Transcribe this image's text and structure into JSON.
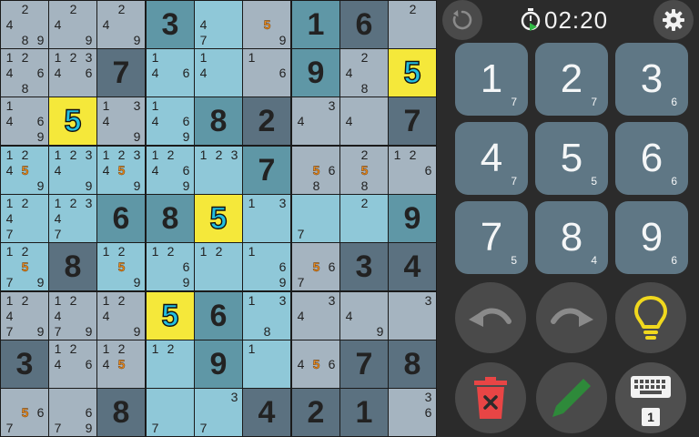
{
  "timer": {
    "value": "02:20"
  },
  "colors": {
    "cell_gray": "#a5b4c0",
    "cell_light": "#8fc8d8",
    "cell_dark": "#5b7180",
    "cell_teal": "#5f97a6",
    "cell_selected": "#f5e83a",
    "highlight_digit": "#22bfe0",
    "highlight_note": "#e88a1c",
    "numpad_button": "#5f7785",
    "panel_background": "#2b2b2b",
    "hint_icon": "#f0d81e",
    "erase_icon": "#e84545",
    "pencil_icon": "#2e8a3a"
  },
  "board": [
    [
      {
        "bg": "gray",
        "notes": [
          "2",
          "4",
          "8",
          "9"
        ]
      },
      {
        "bg": "gray",
        "notes": [
          "2",
          "4",
          "9"
        ]
      },
      {
        "bg": "gray",
        "notes": [
          "2",
          "4",
          "9"
        ]
      },
      {
        "bg": "teal",
        "value": "3"
      },
      {
        "bg": "light",
        "notes": [
          "4",
          "7"
        ]
      },
      {
        "bg": "gray",
        "notes": [
          "5",
          "9"
        ],
        "hl_notes": [
          "5"
        ]
      },
      {
        "bg": "teal",
        "value": "1"
      },
      {
        "bg": "dark",
        "value": "6"
      },
      {
        "bg": "gray",
        "notes": [
          "2"
        ]
      }
    ],
    [
      {
        "bg": "gray",
        "notes": [
          "1",
          "2",
          "4",
          "6",
          "8"
        ]
      },
      {
        "bg": "gray",
        "notes": [
          "1",
          "2",
          "3",
          "4",
          "6"
        ]
      },
      {
        "bg": "dark",
        "value": "7"
      },
      {
        "bg": "light",
        "notes": [
          "1",
          "4",
          "6"
        ]
      },
      {
        "bg": "light",
        "notes": [
          "1",
          "4"
        ]
      },
      {
        "bg": "gray",
        "notes": [
          "1",
          "6"
        ]
      },
      {
        "bg": "teal",
        "value": "9"
      },
      {
        "bg": "gray",
        "notes": [
          "2",
          "4",
          "8"
        ]
      },
      {
        "bg": "yellow",
        "value": "5",
        "hl": true
      }
    ],
    [
      {
        "bg": "gray",
        "notes": [
          "1",
          "4",
          "6",
          "9"
        ]
      },
      {
        "bg": "yellow",
        "value": "5",
        "hl": true
      },
      {
        "bg": "gray",
        "notes": [
          "1",
          "3",
          "4",
          "9"
        ]
      },
      {
        "bg": "light",
        "notes": [
          "1",
          "4",
          "6",
          "9"
        ]
      },
      {
        "bg": "teal",
        "value": "8"
      },
      {
        "bg": "dark",
        "value": "2"
      },
      {
        "bg": "gray",
        "notes": [
          "3",
          "4"
        ]
      },
      {
        "bg": "gray",
        "notes": [
          "4"
        ]
      },
      {
        "bg": "dark",
        "value": "7"
      }
    ],
    [
      {
        "bg": "light",
        "notes": [
          "1",
          "2",
          "4",
          "5",
          "9"
        ],
        "hl_notes": [
          "5"
        ]
      },
      {
        "bg": "light",
        "notes": [
          "1",
          "2",
          "3",
          "4",
          "9"
        ]
      },
      {
        "bg": "light",
        "notes": [
          "1",
          "2",
          "3",
          "4",
          "5",
          "9"
        ],
        "hl_notes": [
          "5"
        ]
      },
      {
        "bg": "light",
        "notes": [
          "1",
          "2",
          "4",
          "6",
          "9"
        ]
      },
      {
        "bg": "light",
        "notes": [
          "1",
          "2",
          "3"
        ]
      },
      {
        "bg": "teal",
        "value": "7"
      },
      {
        "bg": "gray",
        "notes": [
          "5",
          "6",
          "8"
        ],
        "hl_notes": [
          "5"
        ]
      },
      {
        "bg": "gray",
        "notes": [
          "2",
          "5",
          "8"
        ],
        "hl_notes": [
          "5"
        ]
      },
      {
        "bg": "gray",
        "notes": [
          "1",
          "2",
          "6"
        ]
      }
    ],
    [
      {
        "bg": "light",
        "notes": [
          "1",
          "2",
          "4",
          "7"
        ]
      },
      {
        "bg": "light",
        "notes": [
          "1",
          "2",
          "3",
          "4",
          "7"
        ]
      },
      {
        "bg": "teal",
        "value": "6"
      },
      {
        "bg": "teal",
        "value": "8"
      },
      {
        "bg": "yellow",
        "value": "5",
        "hl": true
      },
      {
        "bg": "light",
        "notes": [
          "1",
          "3"
        ]
      },
      {
        "bg": "light",
        "notes": [
          "7"
        ]
      },
      {
        "bg": "light",
        "notes": [
          "2"
        ]
      },
      {
        "bg": "teal",
        "value": "9"
      }
    ],
    [
      {
        "bg": "light",
        "notes": [
          "1",
          "2",
          "5",
          "7",
          "9"
        ],
        "hl_notes": [
          "5"
        ]
      },
      {
        "bg": "dark",
        "value": "8"
      },
      {
        "bg": "light",
        "notes": [
          "1",
          "2",
          "5",
          "9"
        ],
        "hl_notes": [
          "5"
        ]
      },
      {
        "bg": "light",
        "notes": [
          "1",
          "2",
          "6",
          "9"
        ]
      },
      {
        "bg": "light",
        "notes": [
          "1",
          "2"
        ]
      },
      {
        "bg": "light",
        "notes": [
          "1",
          "6",
          "9"
        ]
      },
      {
        "bg": "gray",
        "notes": [
          "5",
          "6",
          "7"
        ],
        "hl_notes": [
          "5"
        ]
      },
      {
        "bg": "dark",
        "value": "3"
      },
      {
        "bg": "dark",
        "value": "4"
      }
    ],
    [
      {
        "bg": "gray",
        "notes": [
          "1",
          "2",
          "4",
          "7",
          "9"
        ]
      },
      {
        "bg": "gray",
        "notes": [
          "1",
          "2",
          "4",
          "7",
          "9"
        ]
      },
      {
        "bg": "gray",
        "notes": [
          "1",
          "2",
          "4",
          "9"
        ]
      },
      {
        "bg": "yellow",
        "value": "5",
        "hl": true
      },
      {
        "bg": "teal",
        "value": "6"
      },
      {
        "bg": "light",
        "notes": [
          "1",
          "3",
          "8"
        ]
      },
      {
        "bg": "gray",
        "notes": [
          "3",
          "4"
        ]
      },
      {
        "bg": "gray",
        "notes": [
          "4",
          "9"
        ]
      },
      {
        "bg": "gray",
        "notes": [
          "3"
        ]
      }
    ],
    [
      {
        "bg": "dark",
        "value": "3"
      },
      {
        "bg": "gray",
        "notes": [
          "1",
          "2",
          "4",
          "6"
        ]
      },
      {
        "bg": "gray",
        "notes": [
          "1",
          "2",
          "4",
          "5"
        ],
        "hl_notes": [
          "5"
        ]
      },
      {
        "bg": "light",
        "notes": [
          "1",
          "2"
        ]
      },
      {
        "bg": "teal",
        "value": "9"
      },
      {
        "bg": "light",
        "notes": [
          "1"
        ]
      },
      {
        "bg": "gray",
        "notes": [
          "4",
          "5",
          "6"
        ],
        "hl_notes": [
          "5"
        ]
      },
      {
        "bg": "dark",
        "value": "7"
      },
      {
        "bg": "dark",
        "value": "8"
      }
    ],
    [
      {
        "bg": "gray",
        "notes": [
          "5",
          "6",
          "7"
        ],
        "hl_notes": [
          "5"
        ]
      },
      {
        "bg": "gray",
        "notes": [
          "6",
          "7",
          "9"
        ]
      },
      {
        "bg": "dark",
        "value": "8"
      },
      {
        "bg": "light",
        "notes": [
          "7"
        ]
      },
      {
        "bg": "light",
        "notes": [
          "3",
          "7"
        ]
      },
      {
        "bg": "dark",
        "value": "4"
      },
      {
        "bg": "dark",
        "value": "2"
      },
      {
        "bg": "dark",
        "value": "1"
      },
      {
        "bg": "gray",
        "notes": [
          "3",
          "6"
        ]
      }
    ]
  ],
  "numpad": [
    {
      "digit": "1",
      "count": "7"
    },
    {
      "digit": "2",
      "count": "7"
    },
    {
      "digit": "3",
      "count": "6"
    },
    {
      "digit": "4",
      "count": "7"
    },
    {
      "digit": "5",
      "count": "5"
    },
    {
      "digit": "6",
      "count": "6"
    },
    {
      "digit": "7",
      "count": "5"
    },
    {
      "digit": "8",
      "count": "4"
    },
    {
      "digit": "9",
      "count": "6"
    }
  ],
  "toolbar": {
    "restart_icon": "restart-icon",
    "timer_icon": "stopwatch-icon",
    "settings_icon": "gear-icon",
    "undo_icon": "undo-icon",
    "redo_icon": "redo-icon",
    "hint_icon": "lightbulb-icon",
    "erase_icon": "trash-icon",
    "pencil_icon": "pencil-icon",
    "keyboard_icon": "keyboard-icon",
    "keyboard_mode": "1"
  }
}
